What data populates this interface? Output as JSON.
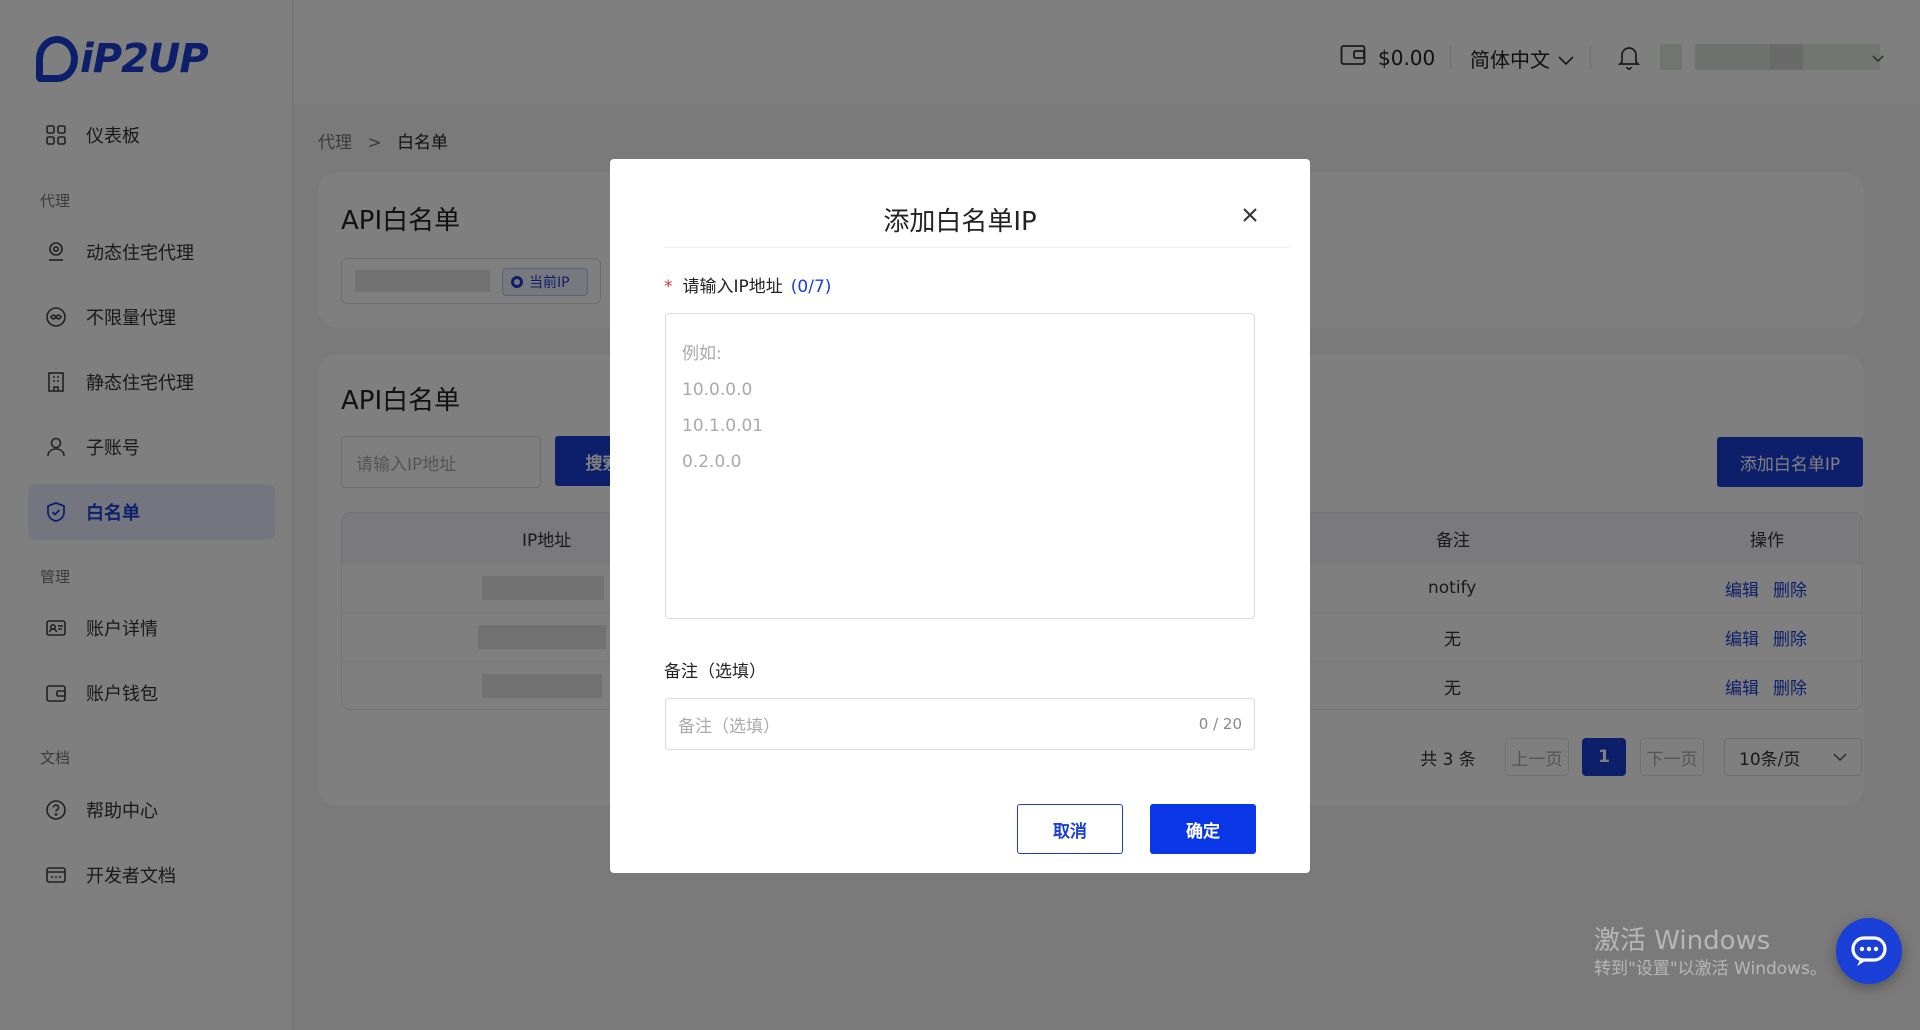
{
  "brand": {
    "logo_text": "iP2UP",
    "color": "#1a3fd6"
  },
  "sidebar": {
    "items": [
      {
        "label": "仪表板",
        "icon": "dashboard-icon"
      },
      {
        "group": "代理"
      },
      {
        "label": "动态住宅代理",
        "icon": "location-pin-icon"
      },
      {
        "label": "不限量代理",
        "icon": "infinity-icon"
      },
      {
        "label": "静态住宅代理",
        "icon": "building-icon"
      },
      {
        "label": "子账号",
        "icon": "user-icon"
      },
      {
        "label": "白名单",
        "icon": "shield-icon",
        "active": true
      },
      {
        "group": "管理"
      },
      {
        "label": "账户详情",
        "icon": "id-card-icon"
      },
      {
        "label": "账户钱包",
        "icon": "wallet-icon"
      },
      {
        "group": "文档"
      },
      {
        "label": "帮助中心",
        "icon": "question-icon"
      },
      {
        "label": "开发者文档",
        "icon": "api-doc-icon"
      }
    ]
  },
  "header": {
    "balance": "$0.00",
    "language": "简体中文"
  },
  "breadcrumb": {
    "parent": "代理",
    "sep": ">",
    "current": "白名单"
  },
  "top_card": {
    "title": "API白名单",
    "current_ip_label": "当前IP"
  },
  "list_card": {
    "title": "API白名单",
    "search_placeholder": "请输入IP地址",
    "search_button": "搜索",
    "add_button": "添加白名单IP",
    "columns": {
      "ip": "IP地址",
      "note": "备注",
      "ops": "操作"
    },
    "rows": [
      {
        "note": "notify",
        "edit": "编辑",
        "delete": "删除"
      },
      {
        "note": "无",
        "edit": "编辑",
        "delete": "删除"
      },
      {
        "note": "无",
        "edit": "编辑",
        "delete": "删除"
      }
    ],
    "pager": {
      "total": "共 3 条",
      "prev": "上一页",
      "page": "1",
      "next": "下一页",
      "size": "10条/页"
    }
  },
  "modal": {
    "title": "添加白名单IP",
    "ip_label": "请输入IP地址",
    "ip_counter": "(0/7)",
    "ip_placeholder_lines": [
      "例如:",
      "10.0.0.0",
      "10.1.0.01",
      "0.2.0.0"
    ],
    "note_label": "备注（选填）",
    "note_placeholder": "备注（选填）",
    "note_counter": "0 / 20",
    "cancel": "取消",
    "confirm": "确定"
  },
  "watermark": {
    "line1": "激活 Windows",
    "line2": "转到\"设置\"以激活 Windows。"
  }
}
